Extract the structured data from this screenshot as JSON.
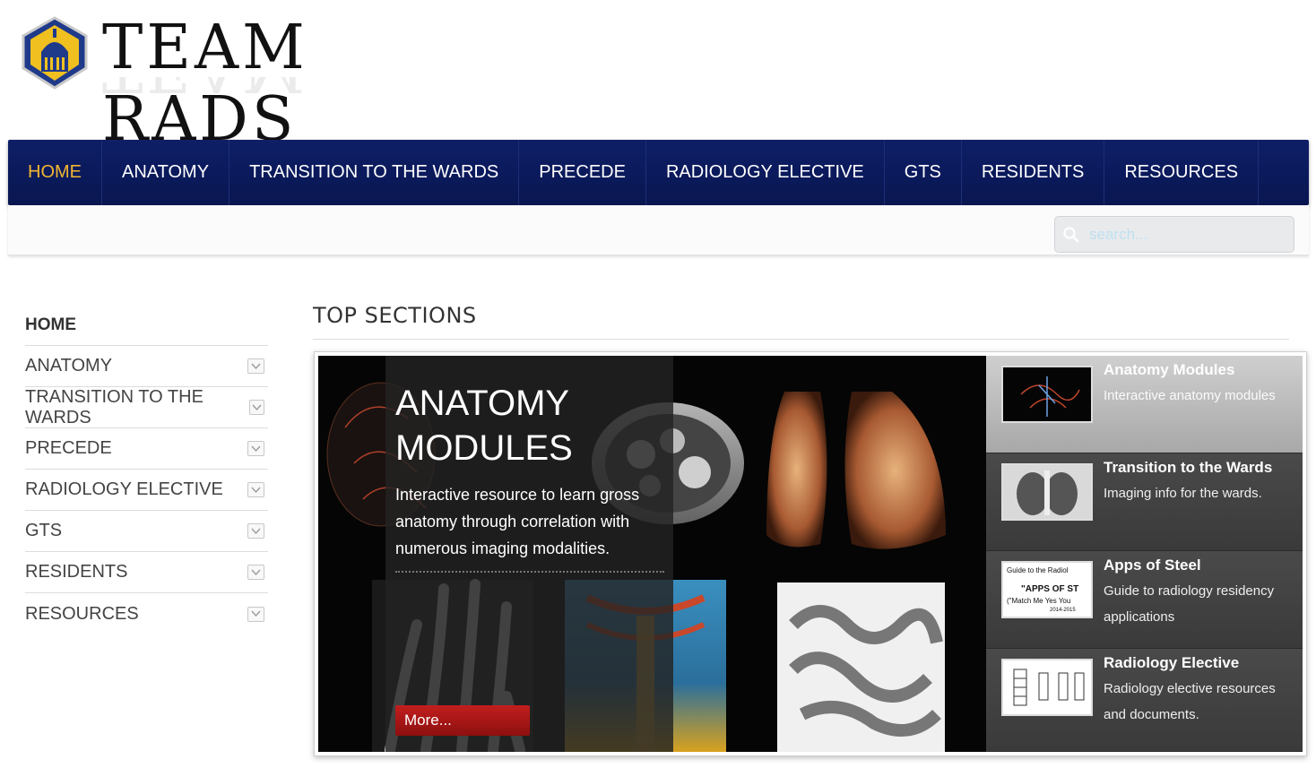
{
  "site": {
    "logo_text": "TEAM RADS"
  },
  "nav": {
    "items": [
      {
        "label": "HOME"
      },
      {
        "label": "ANATOMY"
      },
      {
        "label": "TRANSITION TO THE WARDS"
      },
      {
        "label": "PRECEDE"
      },
      {
        "label": "RADIOLOGY ELECTIVE"
      },
      {
        "label": "GTS"
      },
      {
        "label": "RESIDENTS"
      },
      {
        "label": "RESOURCES"
      }
    ]
  },
  "search": {
    "placeholder": "search..."
  },
  "sidebar": {
    "items": [
      {
        "label": "HOME"
      },
      {
        "label": "ANATOMY"
      },
      {
        "label": "TRANSITION TO THE WARDS"
      },
      {
        "label": "PRECEDE"
      },
      {
        "label": "RADIOLOGY ELECTIVE"
      },
      {
        "label": "GTS"
      },
      {
        "label": "RESIDENTS"
      },
      {
        "label": "RESOURCES"
      }
    ]
  },
  "main": {
    "section_title": "TOP SECTIONS",
    "slide": {
      "title_line1": "ANATOMY",
      "title_line2": "MODULES",
      "text": "Interactive resource to learn gross anatomy through correlation with numerous imaging modalities.",
      "more_label": "More..."
    },
    "thumbs": [
      {
        "title": "Anatomy Modules",
        "desc": "Interactive anatomy modules"
      },
      {
        "title": "Transition to the Wards",
        "desc": "Imaging info for the wards."
      },
      {
        "title": "Apps of Steel",
        "desc": "Guide to radiology residency applications",
        "thumb_text_1": "Guide to the Radiol",
        "thumb_text_2": "\"APPS OF ST",
        "thumb_text_3": "(\"Match Me Yes You",
        "thumb_text_4": "2014-2015"
      },
      {
        "title": "Radiology Elective",
        "desc": "Radiology elective resources and documents."
      }
    ]
  },
  "colors": {
    "nav_bg": "#0b1a5c",
    "nav_active": "#f2b632",
    "more_button": "#b01818"
  }
}
